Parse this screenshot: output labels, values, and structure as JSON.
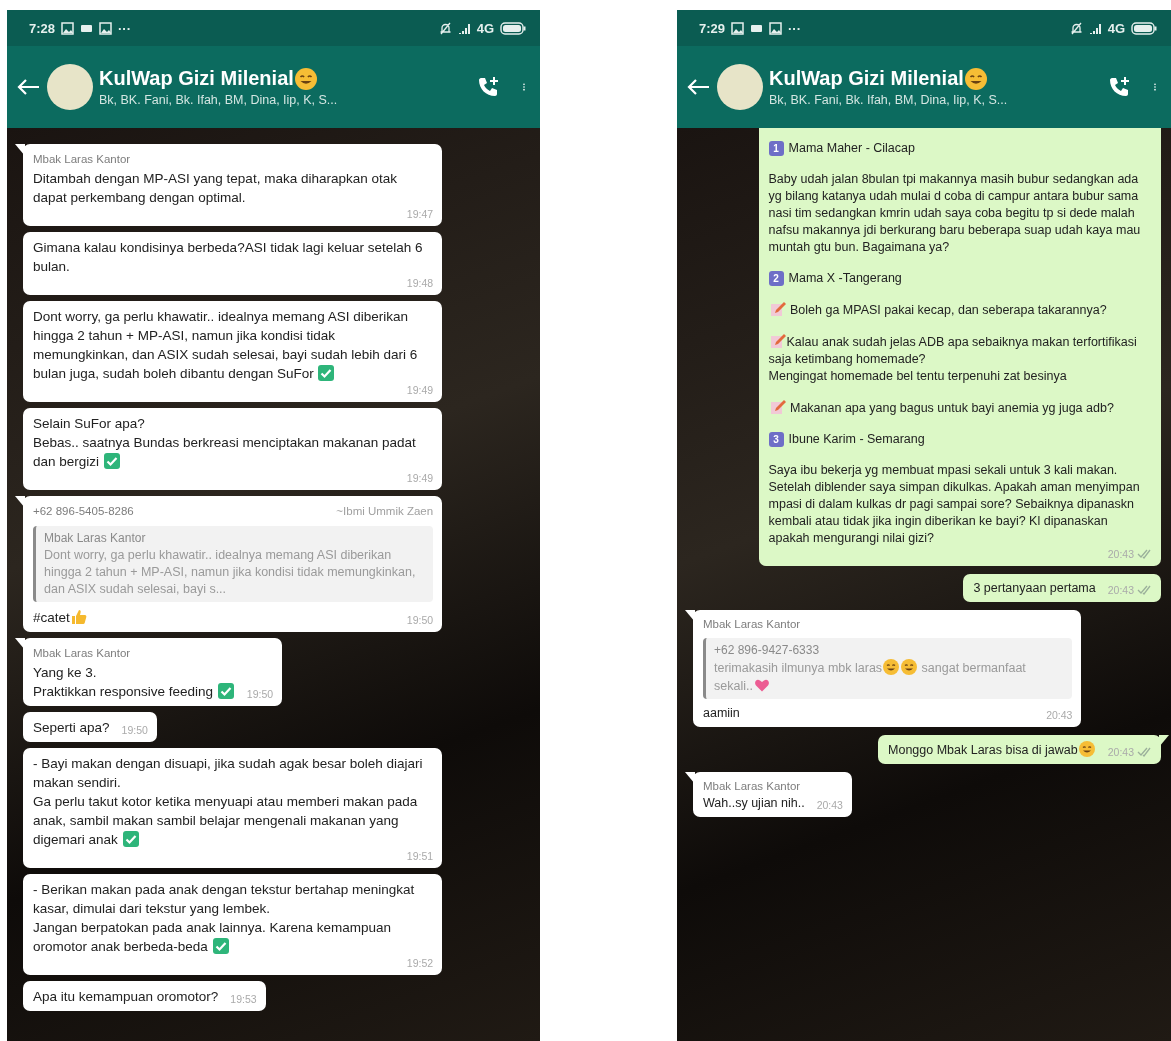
{
  "phones": [
    {
      "status_bar": {
        "time": "7:28",
        "more": "···",
        "network": "4G"
      },
      "header": {
        "title": [
          {
            "kind": "text",
            "text": "KulWap Gizi Milenial"
          },
          {
            "kind": "hug"
          }
        ],
        "subtitle": "Bk, BK. Fani, Bk. Ifah, BM, Dina, Iip, K, S..."
      },
      "messages": [
        {
          "kind": "in",
          "tail": true,
          "sender": "Mbak Laras Kantor",
          "parts": [
            {
              "kind": "text",
              "text": "Ditambah dengan MP-ASI yang tepat, maka diharapkan otak dapat perkembang dengan optimal."
            }
          ],
          "time": "19:47"
        },
        {
          "kind": "in",
          "tail": false,
          "parts": [
            {
              "kind": "text",
              "text": "Gimana kalau kondisinya berbeda?ASI tidak lagi keluar setelah 6 bulan."
            }
          ],
          "time": "19:48"
        },
        {
          "kind": "in",
          "tail": false,
          "parts": [
            {
              "kind": "text",
              "text": "Dont worry, ga perlu khawatir.. idealnya memang ASI diberikan hingga 2 tahun + MP-ASI, namun jika kondisi tidak memungkinkan, dan ASIX sudah selesai, bayi sudah lebih dari 6 bulan juga, sudah boleh dibantu dengan SuFor "
            },
            {
              "kind": "check"
            }
          ],
          "time": "19:49"
        },
        {
          "kind": "in",
          "tail": false,
          "parts": [
            {
              "kind": "text",
              "text": "Selain SuFor apa?\nBebas.. saatnya Bundas berkreasi menciptakan makanan padat dan bergizi "
            },
            {
              "kind": "check"
            }
          ],
          "time": "19:49"
        },
        {
          "kind": "in",
          "tail": true,
          "sender": "+62 896-5405-8286",
          "push_name": "~Ibmi Ummik Zaen",
          "quote": {
            "sender": "Mbak Laras Kantor",
            "parts": [
              {
                "kind": "text",
                "text": "Dont worry, ga perlu khawatir.. idealnya memang ASI diberikan hingga 2 tahun + MP-ASI, namun jika kondisi tidak memungkinkan, dan ASIX sudah selesai, bayi s..."
              }
            ]
          },
          "parts": [
            {
              "kind": "text",
              "text": "#catet"
            },
            {
              "kind": "thumbs"
            }
          ],
          "time": "19:50"
        },
        {
          "kind": "in",
          "tail": true,
          "sender": "Mbak Laras Kantor",
          "parts": [
            {
              "kind": "text",
              "text": "Yang ke 3.\nPraktikkan responsive feeding "
            },
            {
              "kind": "check"
            }
          ],
          "time": "19:50"
        },
        {
          "kind": "in",
          "tail": false,
          "parts": [
            {
              "kind": "text",
              "text": "Seperti apa?"
            }
          ],
          "time": "19:50"
        },
        {
          "kind": "in",
          "tail": false,
          "parts": [
            {
              "kind": "text",
              "text": "- Bayi makan dengan disuapi, jika sudah agak besar boleh diajari makan sendiri.\nGa perlu takut kotor ketika menyuapi atau memberi makan pada anak, sambil makan sambil belajar mengenali makanan yang digemari anak "
            },
            {
              "kind": "check"
            }
          ],
          "time": "19:51"
        },
        {
          "kind": "in",
          "tail": false,
          "parts": [
            {
              "kind": "text",
              "text": "- Berikan makan pada anak dengan tekstur bertahap meningkat kasar, dimulai dari tekstur yang lembek.\nJangan berpatokan pada anak  lainnya. Karena kemampuan oromotor anak berbeda-beda "
            },
            {
              "kind": "check"
            }
          ],
          "time": "19:52"
        },
        {
          "kind": "in",
          "tail": false,
          "parts": [
            {
              "kind": "text",
              "text": "Apa itu kemampuan oromotor?"
            }
          ],
          "time": "19:53"
        }
      ]
    },
    {
      "status_bar": {
        "time": "7:29",
        "more": "···",
        "network": "4G"
      },
      "header": {
        "title": [
          {
            "kind": "text",
            "text": "KulWap Gizi Milenial"
          },
          {
            "kind": "hug"
          }
        ],
        "subtitle": "Bk, BK. Fani, Bk. Ifah, BM, Dina, Iip, K, S..."
      },
      "messages": [
        {
          "kind": "out",
          "tail": false,
          "blocks": [
            {
              "kind": "numbered",
              "number": "1",
              "text": "Mama Maher - Cilacap"
            },
            {
              "kind": "paragraph",
              "parts": [
                {
                  "kind": "text",
                  "text": "Baby udah jalan 8bulan tpi makannya masih bubur sedangkan ada yg bilang katanya udah mulai d coba di campur antara bubur sama nasi tim sedangkan kmrin udah saya coba begitu tp si dede malah nafsu makannya jdi berkurang baru beberapa suap udah kaya mau muntah gtu bun. Bagaimana ya?"
                }
              ]
            },
            {
              "kind": "numbered",
              "number": "2",
              "text": "Mama X -Tangerang"
            },
            {
              "kind": "paragraph",
              "parts": [
                {
                  "kind": "memo"
                },
                {
                  "kind": "text",
                  "text": " Boleh ga MPASI pakai kecap,  dan seberapa takarannya?"
                }
              ]
            },
            {
              "kind": "paragraph",
              "parts": [
                {
                  "kind": "memo"
                },
                {
                  "kind": "text",
                  "text": "Kalau anak sudah jelas ADB apa sebaiknya makan terfortifikasi saja ketimbang homemade?\nMengingat homemade bel tentu terpenuhi zat besinya"
                }
              ]
            },
            {
              "kind": "paragraph",
              "parts": [
                {
                  "kind": "memo"
                },
                {
                  "kind": "text",
                  "text": " Makanan apa yang bagus untuk bayi anemia yg juga adb?"
                }
              ]
            },
            {
              "kind": "numbered",
              "number": "3",
              "text": "Ibune Karim - Semarang"
            },
            {
              "kind": "paragraph",
              "parts": [
                {
                  "kind": "text",
                  "text": "Saya ibu bekerja yg membuat mpasi sekali untuk 3 kali makan. Setelah diblender saya simpan dikulkas. Apakah aman menyimpan mpasi di dalam kulkas dr pagi sampai sore? Sebaiknya dipanaskn kembali atau tidak jika ingin diberikan ke bayi? Kl dipanaskan apakah mengurangi nilai gizi?"
                }
              ]
            }
          ],
          "time": "20:43"
        },
        {
          "kind": "out",
          "tail": false,
          "parts": [
            {
              "kind": "text",
              "text": "3 pertanyaan pertama"
            }
          ],
          "time": "20:43"
        },
        {
          "kind": "in",
          "tail": true,
          "sender": "Mbak Laras Kantor",
          "quote": {
            "sender": "+62 896-9427-6333",
            "parts": [
              {
                "kind": "text",
                "text": "terimakasih ilmunya mbk laras"
              },
              {
                "kind": "grin"
              },
              {
                "kind": "grin"
              },
              {
                "kind": "text",
                "text": " sangat bermanfaat sekali.."
              },
              {
                "kind": "heart"
              }
            ]
          },
          "parts": [
            {
              "kind": "text",
              "text": "aamiin"
            }
          ],
          "time": "20:43"
        },
        {
          "kind": "out",
          "tail": true,
          "parts": [
            {
              "kind": "text",
              "text": "Monggo Mbak Laras bisa di jawab"
            },
            {
              "kind": "smile"
            }
          ],
          "time": "20:43"
        },
        {
          "kind": "in",
          "tail": true,
          "sender": "Mbak Laras Kantor",
          "parts": [
            {
              "kind": "text",
              "text": "Wah..sy ujian nih.."
            }
          ],
          "time": "20:43"
        }
      ]
    }
  ]
}
